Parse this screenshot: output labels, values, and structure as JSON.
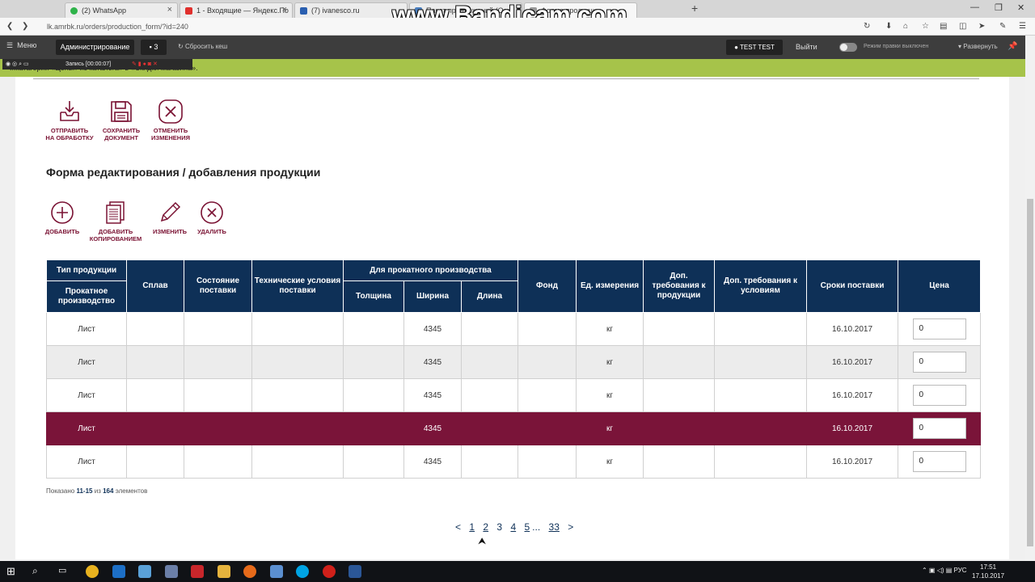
{
  "browser": {
    "tabs": [
      {
        "label": "(2) WhatsApp",
        "color": "#2fb34a"
      },
      {
        "label": "1 - Входящие — Яндекс.По",
        "color": "#e0302d"
      },
      {
        "label": "(7) ivanesco.ru",
        "color": "#2a5fb0"
      },
      {
        "label": "Пакет предложений (Осн",
        "color": "#4a7fbf"
      },
      {
        "label": "Форма продукции",
        "color": "#999999"
      }
    ],
    "url": "lk.amrbk.ru/orders/production_form/?id=240",
    "watermark": "www.Bandicam.com",
    "new_tab": "+"
  },
  "adminbar": {
    "menu": "Меню",
    "administration": "Администрирование",
    "notifications": "3",
    "reset_cache": "Сбросить кеш",
    "user": "TEST TEST",
    "logout": "Выйти",
    "edit_mode_label": "Режим правки",
    "edit_mode_value": "выключен",
    "expand": "Развернуть"
  },
  "recorder": {
    "label": "Запись [00:00:07]"
  },
  "notice": "...катагории «Цены» из каталога» в «Скидки магазина».",
  "doc_actions": [
    {
      "line1": "ОТПРАВИТЬ",
      "line2": "НА ОБРАБОТКУ",
      "icon": "download-tray-icon"
    },
    {
      "line1": "СОХРАНИТЬ",
      "line2": "ДОКУМЕНТ",
      "icon": "save-icon"
    },
    {
      "line1": "ОТМЕНИТЬ",
      "line2": "ИЗМЕНЕНИЯ",
      "icon": "cancel-x-icon"
    }
  ],
  "form_title": "Форма редактирования / добавления продукции",
  "row_actions": [
    {
      "line1": "ДОБАВИТЬ",
      "line2": "",
      "icon": "plus-circle-icon"
    },
    {
      "line1": "ДОБАВИТЬ",
      "line2": "КОПИРОВАНИЕМ",
      "icon": "copy-document-icon"
    },
    {
      "line1": "ИЗМЕНИТЬ",
      "line2": "",
      "icon": "pencil-icon"
    },
    {
      "line1": "УДАЛИТЬ",
      "line2": "",
      "icon": "delete-x-icon"
    }
  ],
  "table": {
    "headers": {
      "product_type": "Тип продукции",
      "rolled": "Прокатное производство",
      "alloy": "Сплав",
      "delivery_state": "Состояние поставки",
      "tech_conditions": "Технические условия поставки",
      "rolling_group": "Для прокатного производства",
      "thickness": "Толщина",
      "width": "Ширина",
      "length": "Длина",
      "fund": "Фонд",
      "unit": "Ед. измерения",
      "extra_product": "Доп. требования к продукции",
      "extra_conditions": "Доп. требования к условиям",
      "delivery_date": "Сроки поставки",
      "price": "Цена"
    },
    "rows": [
      {
        "type": "Лист",
        "alloy": "",
        "state": "",
        "tech": "",
        "thickness": "",
        "width": "4345",
        "length": "",
        "fund": "",
        "unit": "кг",
        "extra_p": "",
        "extra_c": "",
        "date": "16.10.2017",
        "price": "0",
        "style": ""
      },
      {
        "type": "Лист",
        "alloy": "",
        "state": "",
        "tech": "",
        "thickness": "",
        "width": "4345",
        "length": "",
        "fund": "",
        "unit": "кг",
        "extra_p": "",
        "extra_c": "",
        "date": "16.10.2017",
        "price": "0",
        "style": "alt"
      },
      {
        "type": "Лист",
        "alloy": "",
        "state": "",
        "tech": "",
        "thickness": "",
        "width": "4345",
        "length": "",
        "fund": "",
        "unit": "кг",
        "extra_p": "",
        "extra_c": "",
        "date": "16.10.2017",
        "price": "0",
        "style": ""
      },
      {
        "type": "Лист",
        "alloy": "",
        "state": "",
        "tech": "",
        "thickness": "",
        "width": "4345",
        "length": "",
        "fund": "",
        "unit": "кг",
        "extra_p": "",
        "extra_c": "",
        "date": "16.10.2017",
        "price": "0",
        "style": "sel"
      },
      {
        "type": "Лист",
        "alloy": "",
        "state": "",
        "tech": "",
        "thickness": "",
        "width": "4345",
        "length": "",
        "fund": "",
        "unit": "кг",
        "extra_p": "",
        "extra_c": "",
        "date": "16.10.2017",
        "price": "0",
        "style": ""
      }
    ]
  },
  "shown": {
    "prefix": "Показано",
    "range": "11-15",
    "of": "из",
    "total": "164",
    "suffix": "элементов"
  },
  "pagination": {
    "prev": "<",
    "pages": [
      "1",
      "2",
      "3",
      "4",
      "5"
    ],
    "current": "3",
    "ellipsis": "...",
    "last": "33",
    "next": ">"
  },
  "taskbar": {
    "lang": "РУС",
    "time": "17:51",
    "date": "17.10.2017"
  }
}
